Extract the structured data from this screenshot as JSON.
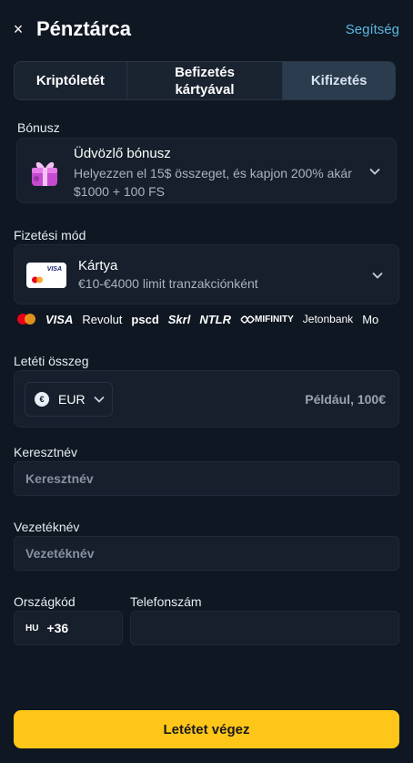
{
  "header": {
    "title": "Pénztárca",
    "help_label": "Segítség",
    "close_label": "×"
  },
  "tabs": [
    {
      "label": "Kriptóletét",
      "active": false
    },
    {
      "label": "Befizetés kártyával",
      "active": false
    },
    {
      "label": "Kifizetés",
      "active": true
    }
  ],
  "bonus": {
    "label": "Bónusz",
    "title": "Üdvözlő bónusz",
    "description": "Helyezzen el 15$ összeget, és kapjon 200% akár $1000 + 100 FS",
    "icon": "gift-icon"
  },
  "payment": {
    "label": "Fizetési mód",
    "title": "Kártya",
    "description": "€10-€4000 limit tranzakciónként",
    "card_brand": "VISA",
    "methods": [
      "VISA",
      "Revolut",
      "pscd",
      "Skrl",
      "NTLR",
      "MIFINITY",
      "Jetonbank",
      "Mo"
    ]
  },
  "amount": {
    "label": "Letéti összeg",
    "currency_symbol": "€",
    "currency": "EUR",
    "placeholder": "Például, 100€"
  },
  "first_name": {
    "label": "Keresztnév",
    "placeholder": "Keresztnév"
  },
  "last_name": {
    "label": "Vezetéknév",
    "placeholder": "Vezetéknév"
  },
  "country_code": {
    "label": "Országkód",
    "flag": "HU",
    "value": "+36"
  },
  "phone": {
    "label": "Telefonszám",
    "value": ""
  },
  "submit_label": "Letétet végez",
  "colors": {
    "background": "#0f1722",
    "accent": "#ffc61a",
    "link": "#5ab7e0"
  }
}
